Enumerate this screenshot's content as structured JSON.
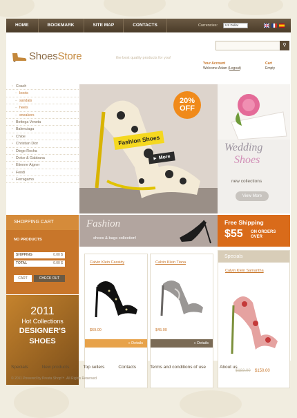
{
  "nav": [
    "HOME",
    "BOOKMARK",
    "SITE MAP",
    "CONTACTS"
  ],
  "currencies_label": "Currencies:",
  "currency_value": "US Dollar",
  "logo": {
    "part1": "Shoes",
    "part2": "Store"
  },
  "tagline": "the best quality products for you!",
  "account": {
    "title": "Your Account",
    "welcome": "Welcome Adam (",
    "logout": "Logout",
    "close": ")"
  },
  "cart_top": {
    "title": "Cart",
    "status": "Empty"
  },
  "categories": [
    {
      "label": "Coach",
      "sub": false
    },
    {
      "label": "boots",
      "sub": true
    },
    {
      "label": "sandals",
      "sub": true
    },
    {
      "label": "heels",
      "sub": true
    },
    {
      "label": "sneakers",
      "sub": true
    },
    {
      "label": "Bottega Veneta",
      "sub": false
    },
    {
      "label": "Balenciaga",
      "sub": false
    },
    {
      "label": "Chloe",
      "sub": false
    },
    {
      "label": "Christian Dior",
      "sub": false
    },
    {
      "label": "Diego Rocha",
      "sub": false
    },
    {
      "label": "Dolce & Gabbana",
      "sub": false
    },
    {
      "label": "Etienne Aigner",
      "sub": false
    },
    {
      "label": "Fendi",
      "sub": false
    },
    {
      "label": "Ferragamo",
      "sub": false
    }
  ],
  "hero": {
    "badge_1": "20%",
    "badge_2": "OFF",
    "tag": "Fashion Shoes",
    "more": "More"
  },
  "wedding": {
    "title_1": "Wedding",
    "title_2": "Shoes",
    "sub": "new collections",
    "button": "View More"
  },
  "cart": {
    "title": "SHOPPING CART",
    "no_products": "NO PRODUCTS",
    "shipping_label": "SHIPPING",
    "shipping_value": "0.00 $",
    "total_label": "TOTAL",
    "total_value": "0.00 $",
    "cart_btn": "CART",
    "checkout_btn": "CHECK OUT"
  },
  "promo": {
    "year": "2011",
    "line1": "Hot Collections",
    "line2": "DESIGNER'S",
    "line3": "SHOES"
  },
  "banner": {
    "title": "Fashion",
    "sub": "shoes & bags collection!"
  },
  "free_ship": {
    "title": "Free Shipping",
    "amount": "$55",
    "line1": "ON ORDERS",
    "line2": "OVER"
  },
  "products": [
    {
      "name": "Calvin Klein Cassidy",
      "price": "$69.00",
      "details": "» Details"
    },
    {
      "name": "Calvin Klein Tiana",
      "price": "$45.00",
      "details": "» Details"
    }
  ],
  "specials": {
    "title": "Specials",
    "name": "Calvin Klein Samantha",
    "old_price": "$183.00",
    "new_price": "$150.00"
  },
  "footer_nav": [
    "Specials",
    "New products",
    "Top sellers",
    "Contacts",
    "Terms and conditions of use",
    "About us"
  ],
  "copyright": "© 2011 Powered by Presta Shop™. All Rights Reserved",
  "colors": {
    "accent": "#c8762a",
    "topbar": "#4a3b28",
    "free_ship": "#d96b1a"
  }
}
